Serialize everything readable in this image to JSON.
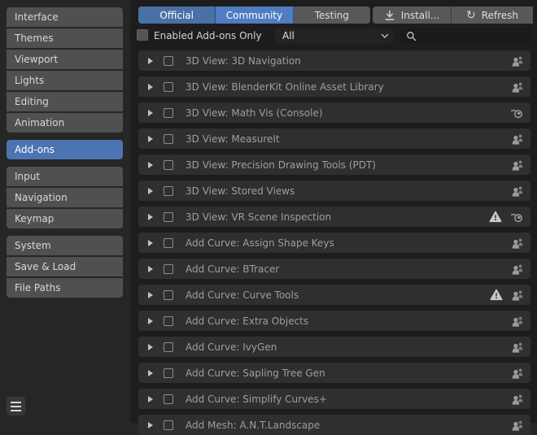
{
  "sidebar": {
    "selected": "Add-ons",
    "groups": [
      {
        "items": [
          "Interface",
          "Themes",
          "Viewport",
          "Lights",
          "Editing",
          "Animation"
        ]
      },
      {
        "items": [
          "Add-ons"
        ]
      },
      {
        "items": [
          "Input",
          "Navigation",
          "Keymap"
        ]
      },
      {
        "items": [
          "System",
          "Save & Load",
          "File Paths"
        ]
      }
    ]
  },
  "header": {
    "filter_tabs": [
      {
        "label": "Official",
        "selected": true,
        "color": "#4a70a8"
      },
      {
        "label": "Community",
        "selected": true,
        "color": "#4f7dc0"
      },
      {
        "label": "Testing",
        "selected": false,
        "color": "#585858"
      }
    ],
    "install_button": "Install...",
    "refresh_button": "Refresh",
    "enabled_only_label": "Enabled Add-ons Only",
    "enabled_only_checked": false,
    "category_dropdown": "All",
    "search_value": ""
  },
  "addons": [
    {
      "title": "3D View: 3D Navigation",
      "enabled": false,
      "warning": false,
      "source": "community"
    },
    {
      "title": "3D View: BlenderKit Online Asset Library",
      "enabled": false,
      "warning": false,
      "source": "community"
    },
    {
      "title": "3D View: Math Vis (Console)",
      "enabled": false,
      "warning": false,
      "source": "official"
    },
    {
      "title": "3D View: MeasureIt",
      "enabled": false,
      "warning": false,
      "source": "community"
    },
    {
      "title": "3D View: Precision Drawing Tools (PDT)",
      "enabled": false,
      "warning": false,
      "source": "community"
    },
    {
      "title": "3D View: Stored Views",
      "enabled": false,
      "warning": false,
      "source": "community"
    },
    {
      "title": "3D View: VR Scene Inspection",
      "enabled": false,
      "warning": true,
      "source": "official"
    },
    {
      "title": "Add Curve: Assign Shape Keys",
      "enabled": false,
      "warning": false,
      "source": "community"
    },
    {
      "title": "Add Curve: BTracer",
      "enabled": false,
      "warning": false,
      "source": "community"
    },
    {
      "title": "Add Curve: Curve Tools",
      "enabled": false,
      "warning": true,
      "source": "community"
    },
    {
      "title": "Add Curve: Extra Objects",
      "enabled": false,
      "warning": false,
      "source": "community"
    },
    {
      "title": "Add Curve: IvyGen",
      "enabled": false,
      "warning": false,
      "source": "community"
    },
    {
      "title": "Add Curve: Sapling Tree Gen",
      "enabled": false,
      "warning": false,
      "source": "community"
    },
    {
      "title": "Add Curve: Simplify Curves+",
      "enabled": false,
      "warning": false,
      "source": "community"
    },
    {
      "title": "Add Mesh: A.N.T.Landscape",
      "enabled": false,
      "warning": false,
      "source": "community"
    }
  ]
}
